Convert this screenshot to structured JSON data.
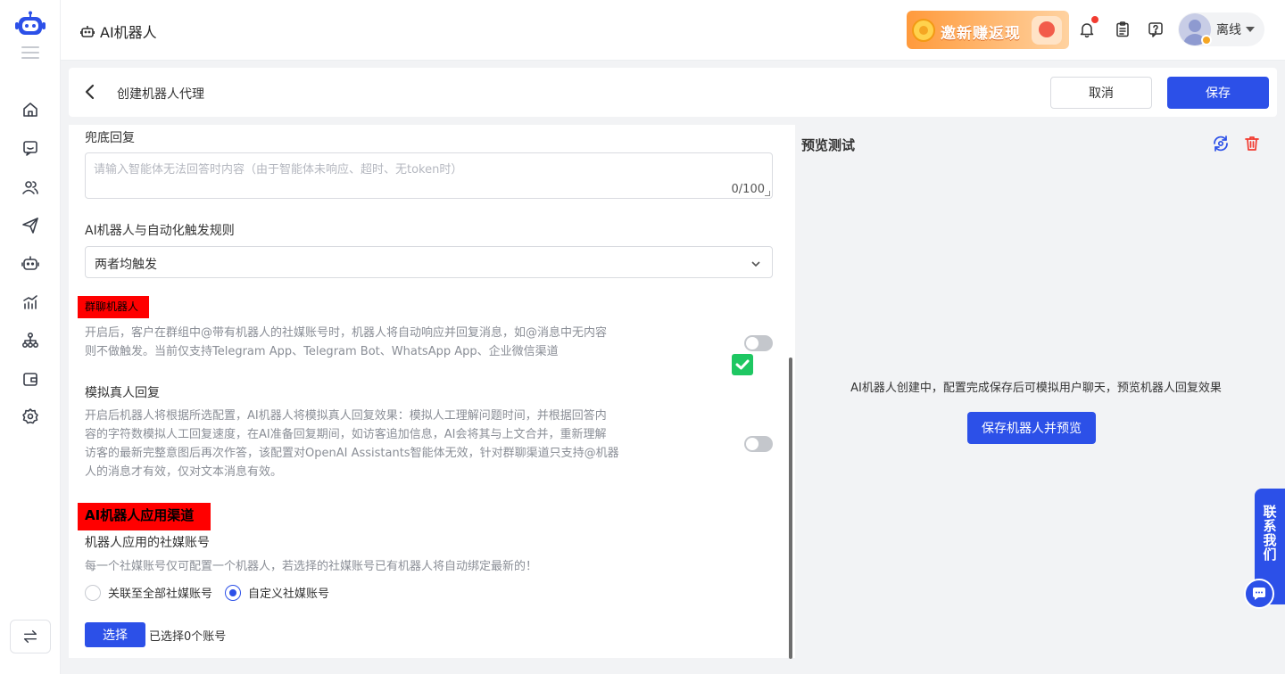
{
  "header": {
    "title": "AI机器人",
    "promo_text": "邀新赚返现",
    "user_status": "离线"
  },
  "subheader": {
    "breadcrumb": "创建机器人代理",
    "cancel_label": "取消",
    "save_label": "保存"
  },
  "form": {
    "fallback": {
      "label": "兜底回复",
      "placeholder": "请输入智能体无法回答时内容（由于智能体未响应、超时、无token时）",
      "counter": "0/100"
    },
    "trigger": {
      "label": "AI机器人与自动化触发规则",
      "value": "两者均触发"
    },
    "group_bot": {
      "label": "群聊机器人",
      "desc_line1": "开启后，客户在群组中@带有机器人的社媒账号时，机器人将自动响应并回复消息，如@消息中无内容",
      "desc_line2": "则不做触发。当前仅支持Telegram App、Telegram Bot、WhatsApp App、企业微信渠道",
      "enabled": false
    },
    "simulate": {
      "label": "模拟真人回复",
      "desc_line1": "开启后机器人将根据所选配置，AI机器人将模拟真人回复效果：模拟人工理解问题时间，并根据回答内",
      "desc_line2": "容的字符数模拟人工回复速度，在AI准备回复期间，如访客追加信息，AI会将其与上文合并，重新理解",
      "desc_line3": "访客的最新完整意图后再次作答，该配置对OpenAI Assistants智能体无效，针对群聊渠道只支持@机器",
      "desc_line4": "人的消息才有效，仅对文本消息有效。",
      "enabled": false
    },
    "channels": {
      "section_title": "AI机器人应用渠道",
      "label": "机器人应用的社媒账号",
      "desc": "每一个社媒账号仅可配置一个机器人，若选择的社媒账号已有机器人将自动绑定最新的！",
      "option_all": "关联至全部社媒账号",
      "option_custom": "自定义社媒账号",
      "selected_option": "custom",
      "choose_label": "选择",
      "selected_text": "已选择0个账号"
    }
  },
  "preview": {
    "title": "预览测试",
    "hint": "AI机器人创建中，配置完成保存后可模拟用户聊天，预览机器人回复效果",
    "button": "保存机器人并预览"
  },
  "contact_widget": {
    "label": "联系我们"
  },
  "colors": {
    "primary": "#2c50e8",
    "highlight": "#ff0000",
    "check": "#1ec762",
    "danger": "#f23b30"
  }
}
